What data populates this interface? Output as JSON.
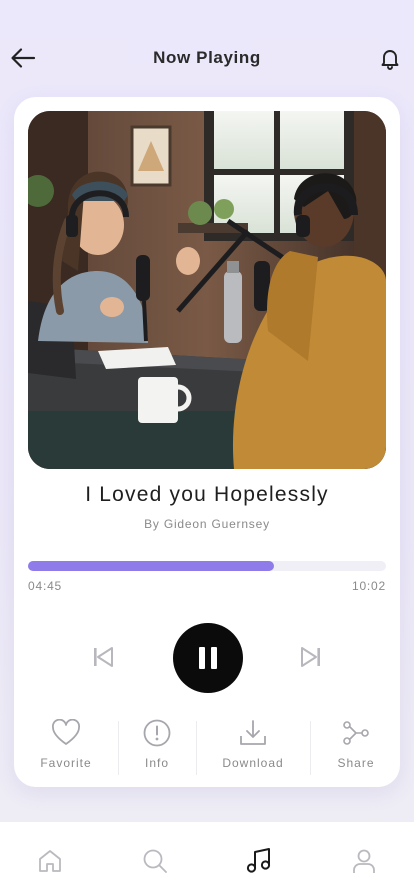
{
  "header": {
    "title": "Now Playing",
    "back_icon": "arrow-left-icon",
    "notification_icon": "bell-icon"
  },
  "track": {
    "title": "I Loved you Hopelessly",
    "artist": "By Gideon Guernsey",
    "cover_image": "podcast-recording-photo",
    "elapsed": "04:45",
    "duration": "10:02",
    "progress_fraction": 0.687
  },
  "controls": {
    "previous_icon": "skip-previous-icon",
    "play_state": "playing",
    "pause_icon": "pause-icon",
    "next_icon": "skip-next-icon"
  },
  "actions": [
    {
      "label": "Favorite",
      "icon": "heart-icon"
    },
    {
      "label": "Info",
      "icon": "info-circle-icon"
    },
    {
      "label": "Download",
      "icon": "download-icon"
    },
    {
      "label": "Share",
      "icon": "share-icon"
    }
  ],
  "tabbar": {
    "items": [
      {
        "icon": "home-icon",
        "active": false
      },
      {
        "icon": "search-icon",
        "active": false
      },
      {
        "icon": "music-note-icon",
        "active": true
      },
      {
        "icon": "profile-icon",
        "active": false
      }
    ]
  },
  "colors": {
    "accent": "#8f7bea",
    "background": "#ece8fb",
    "play_button": "#0b0b0b",
    "muted_text": "#8a8a8a"
  }
}
